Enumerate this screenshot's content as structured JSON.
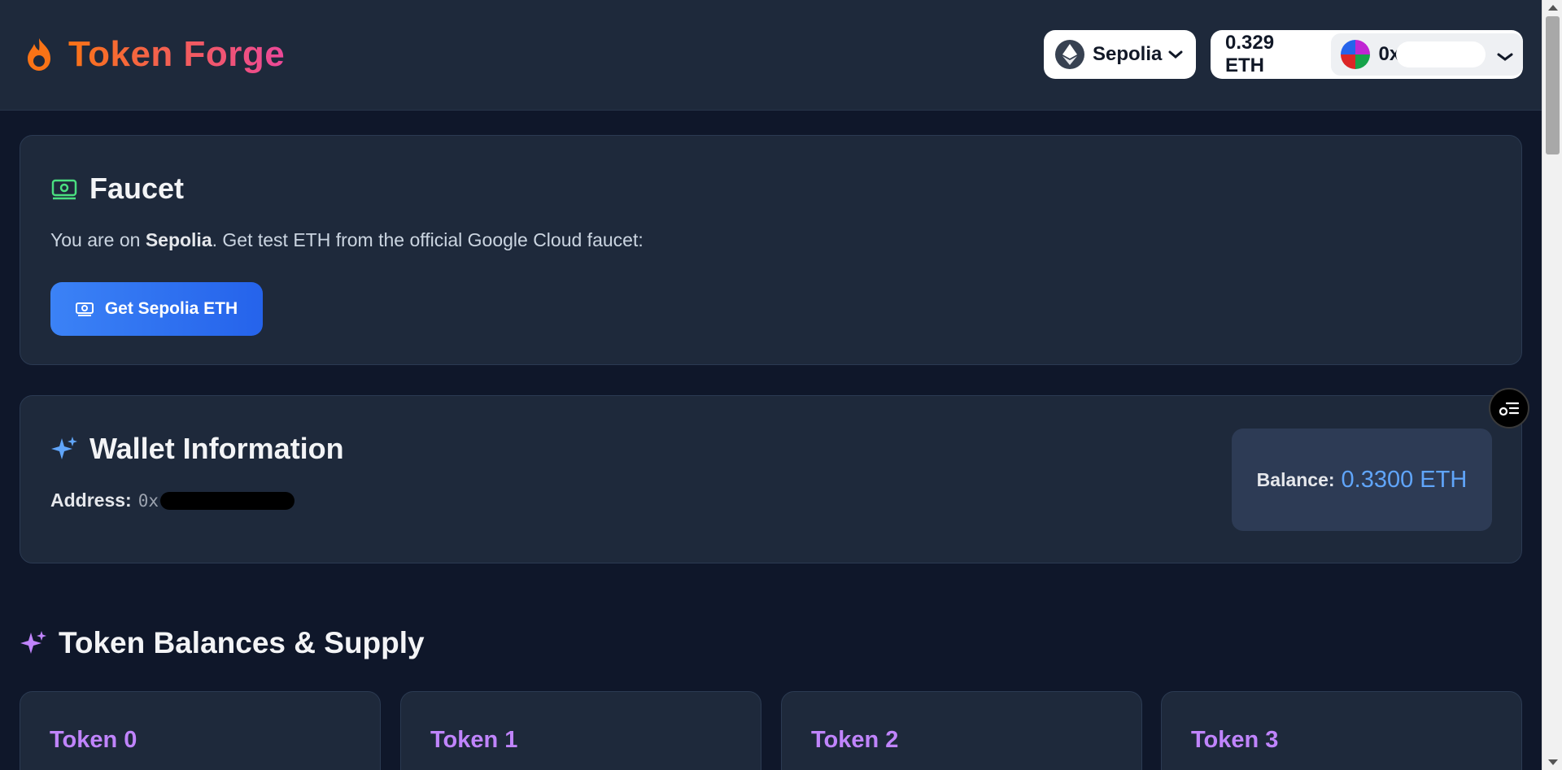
{
  "header": {
    "brand_title": "Token Forge",
    "network": {
      "label": "Sepolia"
    },
    "account": {
      "balance": "0.329 ETH",
      "address_prefix": "0x"
    }
  },
  "faucet": {
    "title": "Faucet",
    "text_prefix": "You are on ",
    "network_name": "Sepolia",
    "text_suffix": ". Get test ETH from the official Google Cloud faucet:",
    "button_label": "Get Sepolia ETH"
  },
  "wallet": {
    "title": "Wallet Information",
    "address_label": "Address:",
    "address_prefix": "0x",
    "balance_label": "Balance:",
    "balance_value": "0.3300 ETH"
  },
  "tokens": {
    "section_title": "Token Balances & Supply",
    "items": [
      {
        "name": "Token 0"
      },
      {
        "name": "Token 1"
      },
      {
        "name": "Token 2"
      },
      {
        "name": "Token 3"
      }
    ]
  },
  "colors": {
    "background": "#0f172a",
    "card": "#1e293b",
    "accent_blue": "#3b82f6",
    "accent_purple": "#c084fc",
    "brand_gradient_start": "#f97316",
    "brand_gradient_end": "#ec4899"
  },
  "icons": {
    "brand": "flame-icon",
    "network": "ethereum-icon",
    "faucet": "money-icon",
    "wallet": "sparkles-icon",
    "tokens": "sparkles-icon",
    "floating": "list-settings-icon"
  }
}
